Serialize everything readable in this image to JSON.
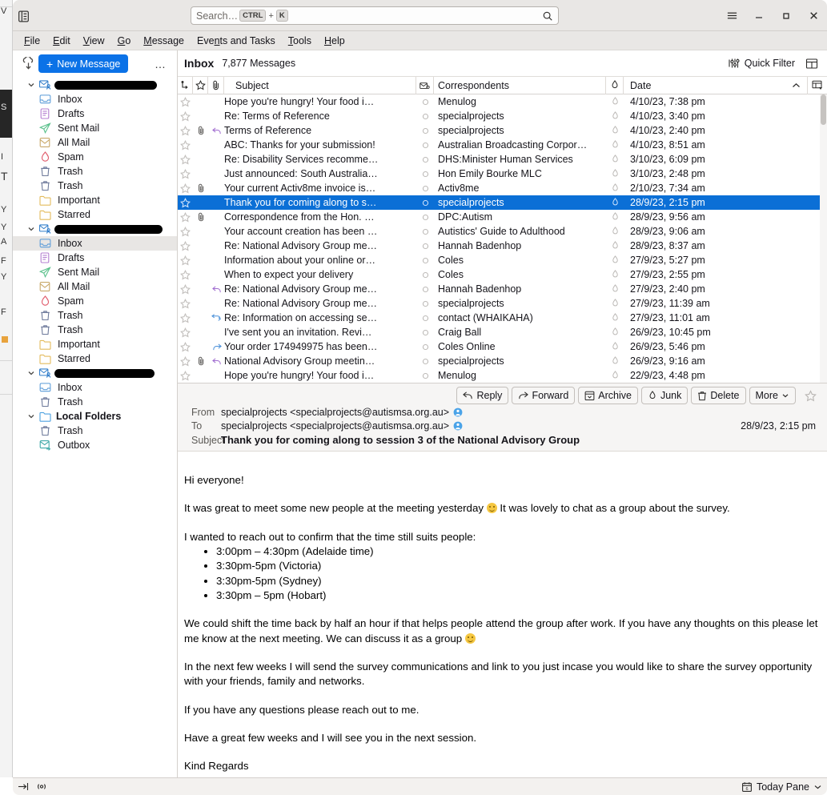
{
  "window": {
    "app_icon": "thunderbird-spaces-icon",
    "controls": {
      "menu": "hamburger-menu",
      "minimize": "minimize",
      "maximize": "maximize",
      "close": "close"
    }
  },
  "search": {
    "placeholder": "Search…",
    "shortcut_mod": "CTRL",
    "shortcut_plus": "+",
    "shortcut_key": "K"
  },
  "menubar": {
    "items": [
      {
        "label": "File",
        "accel": "F"
      },
      {
        "label": "Edit",
        "accel": "E"
      },
      {
        "label": "View",
        "accel": "V"
      },
      {
        "label": "Go",
        "accel": "G"
      },
      {
        "label": "Message",
        "accel": "M"
      },
      {
        "label": "Events and Tasks",
        "accel": "n"
      },
      {
        "label": "Tools",
        "accel": "T"
      },
      {
        "label": "Help",
        "accel": "H"
      }
    ]
  },
  "folder_pane": {
    "new_message_label": "New Message",
    "new_message_plus": "+",
    "more_label": "…",
    "accounts": [
      {
        "name_redacted": true,
        "icon": "mail-account-icon",
        "folders": [
          {
            "label": "Inbox",
            "icon": "inbox-icon"
          },
          {
            "label": "Drafts",
            "icon": "drafts-icon"
          },
          {
            "label": "Sent Mail",
            "icon": "sent-icon"
          },
          {
            "label": "All Mail",
            "icon": "archive-icon"
          },
          {
            "label": "Spam",
            "icon": "spam-icon"
          },
          {
            "label": "Trash",
            "icon": "trash-icon"
          },
          {
            "label": "Trash",
            "icon": "trash-icon"
          },
          {
            "label": "Important",
            "icon": "folder-icon"
          },
          {
            "label": "Starred",
            "icon": "folder-icon"
          }
        ]
      },
      {
        "name_redacted": true,
        "icon": "mail-account-icon",
        "folders": [
          {
            "label": "Inbox",
            "icon": "inbox-icon",
            "selected": true
          },
          {
            "label": "Drafts",
            "icon": "drafts-icon"
          },
          {
            "label": "Sent Mail",
            "icon": "sent-icon"
          },
          {
            "label": "All Mail",
            "icon": "archive-icon"
          },
          {
            "label": "Spam",
            "icon": "spam-icon"
          },
          {
            "label": "Trash",
            "icon": "trash-icon"
          },
          {
            "label": "Trash",
            "icon": "trash-icon"
          },
          {
            "label": "Important",
            "icon": "folder-icon"
          },
          {
            "label": "Starred",
            "icon": "folder-icon"
          }
        ]
      },
      {
        "name_redacted": true,
        "icon": "mail-account-icon",
        "folders": [
          {
            "label": "Inbox",
            "icon": "inbox-icon"
          },
          {
            "label": "Trash",
            "icon": "trash-icon"
          }
        ]
      },
      {
        "label": "Local Folders",
        "icon": "folder-icon",
        "bold": true,
        "folders": [
          {
            "label": "Trash",
            "icon": "trash-icon"
          },
          {
            "label": "Outbox",
            "icon": "outbox-icon"
          }
        ]
      }
    ]
  },
  "message_list": {
    "folder_title": "Inbox",
    "message_count": "7,877 Messages",
    "quick_filter_label": "Quick Filter",
    "columns": {
      "thread": "thread-column",
      "star": "star-column",
      "attachment": "attachment-column",
      "subject": "Subject",
      "unread": "unread-column",
      "correspondents": "Correspondents",
      "read_status": "read-status-column",
      "date": "Date",
      "sort_direction": "ascending",
      "column_picker": "column-picker-icon"
    },
    "rows": [
      {
        "subject": "Hope you're hungry! Your food i…",
        "correspondent": "Menulog",
        "date": "4/10/23, 7:38 pm",
        "attachment": false,
        "thread": "",
        "selected": false
      },
      {
        "subject": "Re: Terms of Reference",
        "correspondent": "specialprojects",
        "date": "4/10/23, 3:40 pm",
        "attachment": false,
        "thread": "",
        "selected": false
      },
      {
        "subject": "Terms of Reference",
        "correspondent": "specialprojects",
        "date": "4/10/23, 2:40 pm",
        "attachment": true,
        "thread": "replied",
        "selected": false
      },
      {
        "subject": "ABC: Thanks for your submission!",
        "correspondent": "Australian Broadcasting Corpor…",
        "date": "4/10/23, 8:51 am",
        "attachment": false,
        "thread": "",
        "selected": false
      },
      {
        "subject": "Re: Disability Services recomme…",
        "correspondent": "DHS:Minister Human Services",
        "date": "3/10/23, 6:09 pm",
        "attachment": false,
        "thread": "",
        "selected": false
      },
      {
        "subject": "Just announced: South Australia…",
        "correspondent": "Hon Emily Bourke MLC",
        "date": "3/10/23, 2:48 pm",
        "attachment": false,
        "thread": "",
        "selected": false
      },
      {
        "subject": "Your current Activ8me invoice is…",
        "correspondent": "Activ8me",
        "date": "2/10/23, 7:34 am",
        "attachment": true,
        "thread": "",
        "selected": false
      },
      {
        "subject": "Thank you for coming along to s…",
        "correspondent": "specialprojects",
        "date": "28/9/23, 2:15 pm",
        "attachment": false,
        "thread": "",
        "selected": true
      },
      {
        "subject": "Correspondence from the Hon. …",
        "correspondent": "DPC:Autism",
        "date": "28/9/23, 9:56 am",
        "attachment": true,
        "thread": "",
        "selected": false
      },
      {
        "subject": "Your account creation has been …",
        "correspondent": "Autistics' Guide to Adulthood",
        "date": "28/9/23, 9:06 am",
        "attachment": false,
        "thread": "",
        "selected": false
      },
      {
        "subject": "Re: National Advisory Group me…",
        "correspondent": "Hannah Badenhop",
        "date": "28/9/23, 8:37 am",
        "attachment": false,
        "thread": "",
        "selected": false
      },
      {
        "subject": "Information about your online or…",
        "correspondent": "Coles",
        "date": "27/9/23, 5:27 pm",
        "attachment": false,
        "thread": "",
        "selected": false
      },
      {
        "subject": "When to expect your delivery",
        "correspondent": "Coles",
        "date": "27/9/23, 2:55 pm",
        "attachment": false,
        "thread": "",
        "selected": false
      },
      {
        "subject": "Re: National Advisory Group me…",
        "correspondent": "Hannah Badenhop",
        "date": "27/9/23, 2:40 pm",
        "attachment": false,
        "thread": "replied",
        "selected": false
      },
      {
        "subject": "Re: National Advisory Group me…",
        "correspondent": "specialprojects",
        "date": "27/9/23, 11:39 am",
        "attachment": false,
        "thread": "",
        "selected": false
      },
      {
        "subject": "Re: Information on accessing se…",
        "correspondent": "contact (WHAIKAHA)",
        "date": "27/9/23, 11:01 am",
        "attachment": false,
        "thread": "replied-forwarded",
        "selected": false
      },
      {
        "subject": "I've sent you an invitation. Revi…",
        "correspondent": "Craig Ball",
        "date": "26/9/23, 10:45 pm",
        "attachment": false,
        "thread": "",
        "selected": false
      },
      {
        "subject": "Your order 174949975 has been…",
        "correspondent": "Coles Online",
        "date": "26/9/23, 5:46 pm",
        "attachment": false,
        "thread": "forwarded",
        "selected": false
      },
      {
        "subject": "National Advisory Group meetin…",
        "correspondent": "specialprojects",
        "date": "26/9/23, 9:16 am",
        "attachment": true,
        "thread": "replied",
        "selected": false
      },
      {
        "subject": "Hope you're hungry! Your food i…",
        "correspondent": "Menulog",
        "date": "22/9/23, 4:48 pm",
        "attachment": false,
        "thread": "",
        "selected": false
      }
    ]
  },
  "reading_pane": {
    "actions": [
      {
        "label": "Reply",
        "icon": "reply-icon"
      },
      {
        "label": "Forward",
        "icon": "forward-icon"
      },
      {
        "label": "Archive",
        "icon": "archive-icon"
      },
      {
        "label": "Junk",
        "icon": "junk-icon"
      },
      {
        "label": "Delete",
        "icon": "trash-icon"
      },
      {
        "label": "More",
        "icon": "chevron-down-icon"
      }
    ],
    "star_icon": "star-icon",
    "from_label": "From",
    "from_value": "specialprojects <specialprojects@autismsa.org.au>",
    "to_label": "To",
    "to_value": "specialprojects <specialprojects@autismsa.org.au>",
    "date": "28/9/23, 2:15 pm",
    "subject_label": "Subject",
    "subject_value": "Thank you for coming along to session 3 of the National Advisory Group",
    "body": {
      "greeting": "Hi everyone!",
      "para1_before": "It was great to meet some new people at the meeting yesterday ",
      "para1_after": " It was lovely to chat as a group about the survey.",
      "para2": "I wanted to reach out to confirm that the time still suits people:",
      "times": [
        "3:00pm – 4:30pm (Adelaide time)",
        "3:30pm-5pm (Victoria)",
        "3:30pm-5pm (Sydney)",
        "3:30pm – 5pm (Hobart)"
      ],
      "para3_before": "We could shift the time back by half an hour if that helps people attend the group after work. If you have any thoughts on this please let me know at the next meeting. We can discuss it as a group ",
      "para3_after": "",
      "para4": "In the next few weeks I will send the survey communications and link to you just incase you would like to share the survey opportunity with your friends, family and networks.",
      "para5": "If you have any questions please reach out to me.",
      "para6": "Have a great few weeks and I will see you in the next session.",
      "para7": "Kind Regards"
    }
  },
  "status_bar": {
    "left_icons": [
      "offline-indicator-icon",
      "activity-indicator-icon"
    ],
    "today_pane_label": "Today Pane",
    "today_pane_icon": "calendar-icon",
    "today_pane_chevron": "chevron-up-icon"
  },
  "colors": {
    "accent_blue": "#0b72e7",
    "selection_blue": "#0b6fd6",
    "chrome_gray": "#e9e7e5",
    "pane_bg": "#ffffff"
  }
}
